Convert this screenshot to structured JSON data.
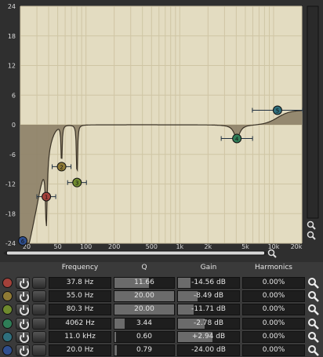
{
  "graph": {
    "y_ticks": [
      "24",
      "18",
      "12",
      "6",
      "0",
      "-6",
      "-12",
      "-18",
      "-24"
    ],
    "x_ticks": [
      "20",
      "50",
      "100",
      "200",
      "500",
      "1k",
      "2k",
      "5k",
      "10k",
      "20k"
    ],
    "colors": {
      "plot_bg": "#e3dcc1",
      "grid": "#cfc5a4",
      "curve_fill": "#8c7f67",
      "curve_line": "#3b3327"
    }
  },
  "table": {
    "headers": {
      "frequency": "Frequency",
      "q": "Q",
      "gain": "Gain",
      "harmonics": "Harmonics"
    },
    "bands": [
      {
        "num": "1",
        "color": "#a3413a",
        "frequency": "37.8 Hz",
        "q": "11.66",
        "gain": "-14.56 dB",
        "harmonics": "0.00%",
        "gain_level": 0.2,
        "q_level": 0.58
      },
      {
        "num": "2",
        "color": "#8f7a35",
        "frequency": "55.0 Hz",
        "q": "20.00",
        "gain": "-8.49 dB",
        "harmonics": "0.00%",
        "gain_level": 0.32,
        "q_level": 1.0
      },
      {
        "num": "3",
        "color": "#6f8a2e",
        "frequency": "80.3 Hz",
        "q": "20.00",
        "gain": "-11.71 dB",
        "harmonics": "0.00%",
        "gain_level": 0.26,
        "q_level": 1.0
      },
      {
        "num": "4",
        "color": "#2f7d57",
        "frequency": "4062 Hz",
        "q": "3.44",
        "gain": "-2.78 dB",
        "harmonics": "0.00%",
        "gain_level": 0.44,
        "q_level": 0.17
      },
      {
        "num": "5",
        "color": "#2f6f7d",
        "frequency": "11.0 kHz",
        "q": "0.60",
        "gain": "+2.94 dB",
        "harmonics": "0.00%",
        "gain_level": 0.56,
        "q_level": 0.03
      },
      {
        "num": "6",
        "color": "#2f4f8f",
        "frequency": "20.0 Hz",
        "q": "0.79",
        "gain": "-24.00 dB",
        "harmonics": "0.00%",
        "gain_level": 0.0,
        "q_level": 0.04
      }
    ]
  }
}
